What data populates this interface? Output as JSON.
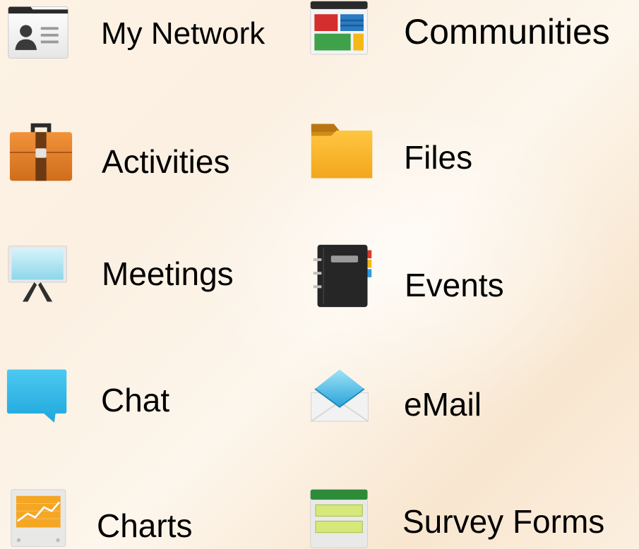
{
  "apps": [
    {
      "label": "My Network",
      "icon": "contact-card-icon"
    },
    {
      "label": "Communities",
      "icon": "dashboard-tiles-icon"
    },
    {
      "label": "Activities",
      "icon": "briefcase-icon"
    },
    {
      "label": "Files",
      "icon": "folder-icon"
    },
    {
      "label": "Meetings",
      "icon": "presentation-board-icon"
    },
    {
      "label": "Events",
      "icon": "notebook-icon"
    },
    {
      "label": "Chat",
      "icon": "speech-bubble-icon"
    },
    {
      "label": "eMail",
      "icon": "envelope-icon"
    },
    {
      "label": "Charts",
      "icon": "line-chart-icon"
    },
    {
      "label": "Survey Forms",
      "icon": "form-icon"
    }
  ],
  "colors": {
    "background": "#fdf3e6",
    "label_text": "#000000"
  }
}
